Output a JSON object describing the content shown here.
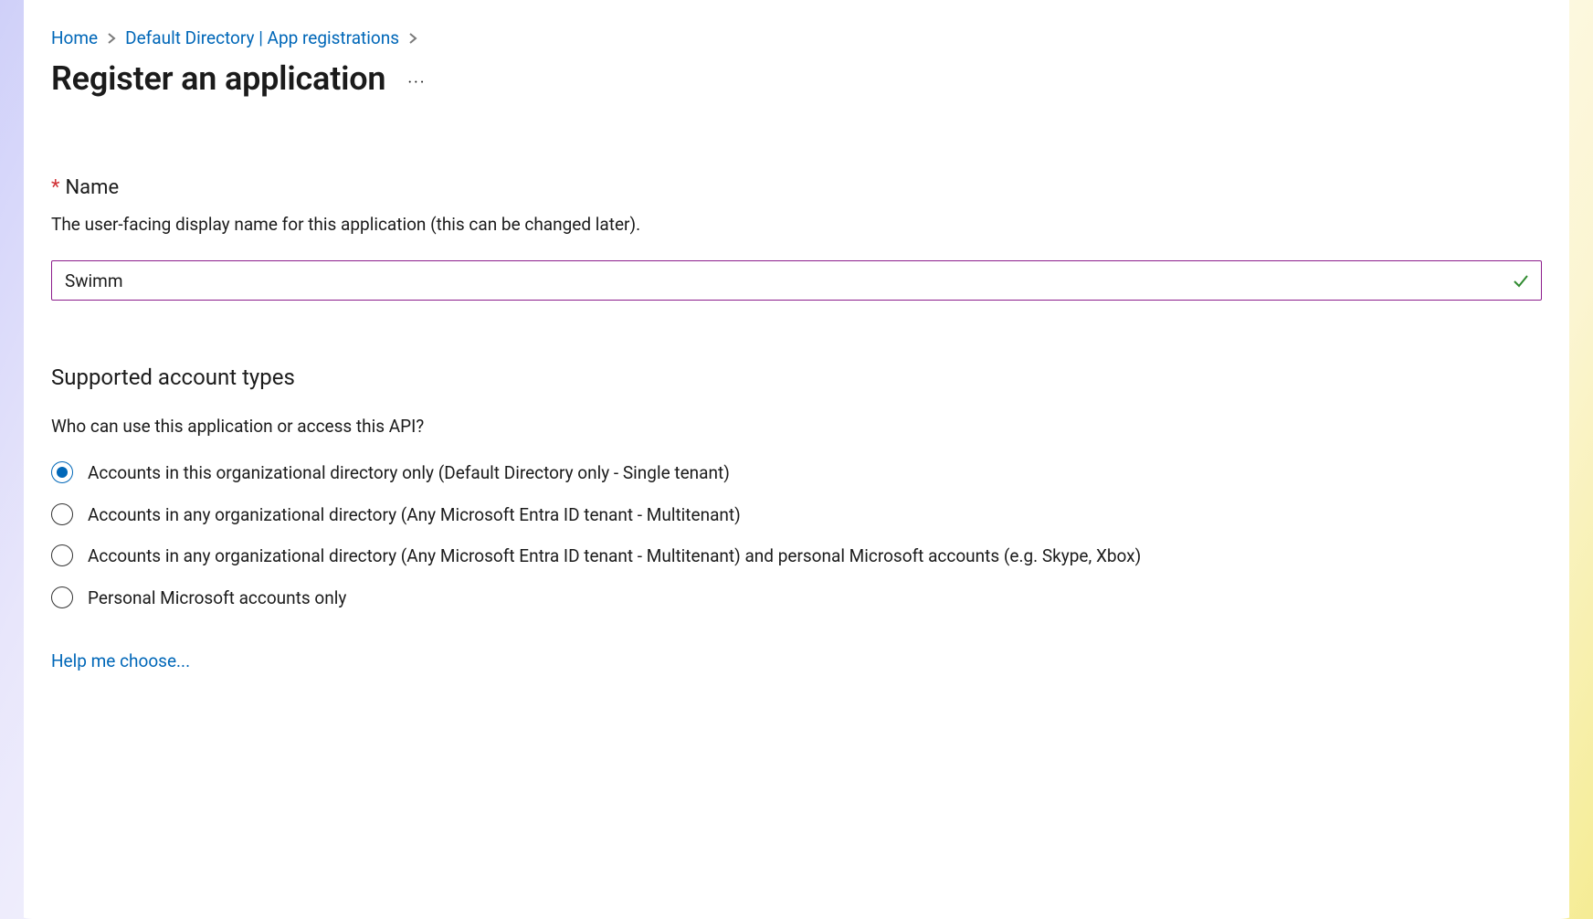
{
  "breadcrumb": {
    "items": [
      {
        "label": "Home"
      },
      {
        "label": "Default Directory | App registrations"
      }
    ]
  },
  "page": {
    "title": "Register an application",
    "more_label": "···"
  },
  "name_field": {
    "label": "Name",
    "required_indicator": "*",
    "description": "The user-facing display name for this application (this can be changed later).",
    "value": "Swimm"
  },
  "account_types": {
    "title": "Supported account types",
    "description": "Who can use this application or access this API?",
    "options": [
      {
        "label": "Accounts in this organizational directory only (Default Directory only - Single tenant)",
        "selected": true
      },
      {
        "label": "Accounts in any organizational directory (Any Microsoft Entra ID tenant - Multitenant)",
        "selected": false
      },
      {
        "label": "Accounts in any organizational directory (Any Microsoft Entra ID tenant - Multitenant) and personal Microsoft accounts (e.g. Skype, Xbox)",
        "selected": false
      },
      {
        "label": "Personal Microsoft accounts only",
        "selected": false
      }
    ],
    "help_link": "Help me choose..."
  }
}
